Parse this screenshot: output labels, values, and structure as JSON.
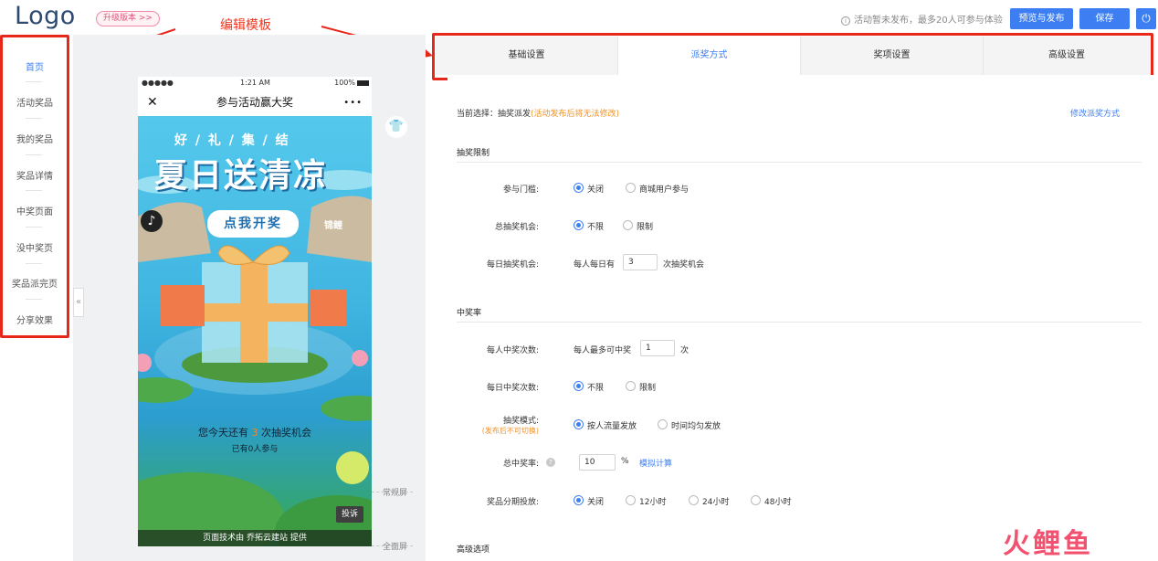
{
  "header": {
    "logo": "Logo",
    "upgrade_badge": "升级版本 >>",
    "annotation_label": "编辑模板",
    "notice": "活动暂未发布，最多20人可参与体验",
    "preview_publish_label": "预览与发布",
    "save_label": "保存",
    "power_icon": "⏻"
  },
  "sidebar": {
    "items": [
      {
        "label": "首页",
        "active": true
      },
      {
        "label": "活动奖品"
      },
      {
        "label": "我的奖品"
      },
      {
        "label": "奖品详情"
      },
      {
        "label": "中奖页面"
      },
      {
        "label": "没中奖页"
      },
      {
        "label": "奖品派完页"
      },
      {
        "label": "分享效果"
      }
    ],
    "collapse_icon": "«"
  },
  "phone": {
    "signal": "●●●●●",
    "time": "1:21 AM",
    "battery": "100%",
    "close_icon": "✕",
    "title": "参与活动赢大奖",
    "more_icon": "•••",
    "poster": {
      "tagline": "好 / 礼 / 集 / 结",
      "headline": "夏日送清凉",
      "cta": "点我开奖",
      "badge": "锦鲤",
      "chance_prefix": "您今天还有",
      "chance_count": "3",
      "chance_suffix": "次抽奖机会",
      "participants": "已有0人参与",
      "complaint": "投诉",
      "footer": "页面技术由 乔拓云建站 提供"
    },
    "music_icon": "♪"
  },
  "canvas": {
    "normal_screen": "常规屏",
    "full_screen": "全面屏",
    "tshirt_icon": "👕"
  },
  "tabs": [
    {
      "label": "基础设置"
    },
    {
      "label": "派奖方式",
      "active": true
    },
    {
      "label": "奖项设置"
    },
    {
      "label": "高级设置"
    }
  ],
  "form": {
    "current_label": "当前选择：抽奖派发",
    "current_hint": "(活动发布后将无法修改)",
    "change_link": "修改派奖方式",
    "section_limit": "抽奖限制",
    "threshold_label": "参与门槛:",
    "threshold_options": [
      "关闭",
      "商城用户参与"
    ],
    "total_chance_label": "总抽奖机会:",
    "total_chance_options": [
      "不限",
      "限制"
    ],
    "daily_chance_label": "每日抽奖机会:",
    "daily_chance_prefix": "每人每日有",
    "daily_chance_value": "3",
    "daily_chance_suffix": "次抽奖机会",
    "section_rate": "中奖率",
    "per_win_label": "每人中奖次数:",
    "per_win_prefix": "每人最多可中奖",
    "per_win_value": "1",
    "per_win_suffix": "次",
    "daily_win_label": "每日中奖次数:",
    "daily_win_options": [
      "不限",
      "限制"
    ],
    "mode_label": "抽奖模式:",
    "mode_hint": "(发布后不可切换)",
    "mode_options": [
      "按人流量发放",
      "时间均匀发放"
    ],
    "total_rate_label": "总中奖率:",
    "total_rate_value": "10",
    "total_rate_unit": "%",
    "simulate_link": "模拟计算",
    "stage_label": "奖品分期投放:",
    "stage_options": [
      "关闭",
      "12小时",
      "24小时",
      "48小时"
    ],
    "section_advanced": "高级选项"
  },
  "watermark": "火鲤鱼"
}
